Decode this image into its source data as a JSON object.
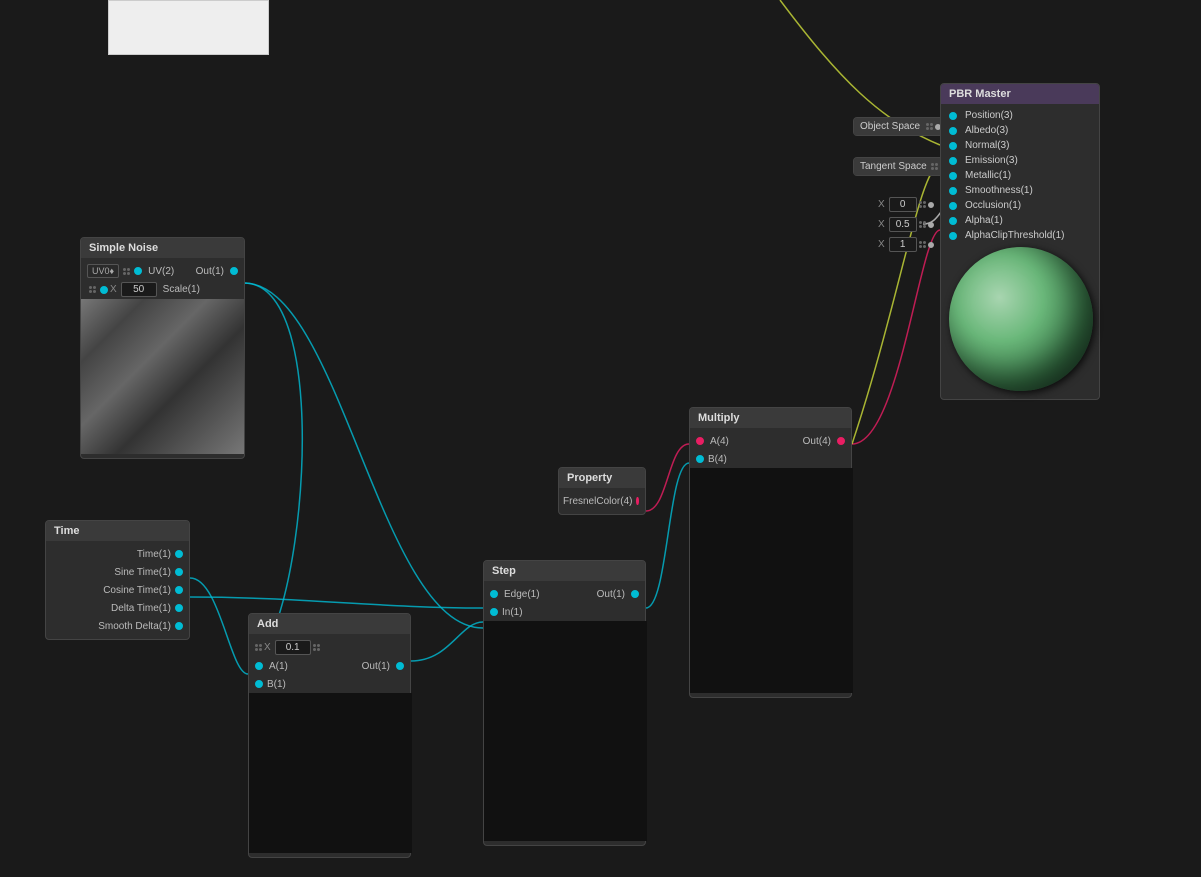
{
  "canvas": {
    "background": "#1e1e1e"
  },
  "whitebox": {
    "label": ""
  },
  "nodes": {
    "pbr_master": {
      "title": "PBR Master",
      "outputs": [
        {
          "label": "Position(3)"
        },
        {
          "label": "Albedo(3)"
        },
        {
          "label": "Normal(3)"
        },
        {
          "label": "Emission(3)"
        },
        {
          "label": "Metallic(1)"
        },
        {
          "label": "Smoothness(1)"
        },
        {
          "label": "Occlusion(1)"
        },
        {
          "label": "Alpha(1)"
        },
        {
          "label": "AlphaClipThreshold(1)"
        }
      ]
    },
    "object_space": {
      "title": "Object Space"
    },
    "tangent_space": {
      "title": "Tangent Space"
    },
    "simple_noise": {
      "title": "Simple Noise",
      "inputs": [
        {
          "label": "UV(2)",
          "type": "cyan"
        },
        {
          "label": "Scale(1)",
          "type": "cyan"
        }
      ],
      "outputs": [
        {
          "label": "Out(1)",
          "type": "cyan"
        }
      ],
      "uv_value": "UV0♦",
      "scale_value": "50"
    },
    "time": {
      "title": "Time",
      "outputs": [
        {
          "label": "Time(1)"
        },
        {
          "label": "Sine Time(1)"
        },
        {
          "label": "Cosine Time(1)"
        },
        {
          "label": "Delta Time(1)"
        },
        {
          "label": "Smooth Delta(1)"
        }
      ]
    },
    "add": {
      "title": "Add",
      "inputs": [
        {
          "label": "A(1)"
        },
        {
          "label": "B(1)"
        }
      ],
      "outputs": [
        {
          "label": "Out(1)"
        }
      ],
      "x_value": "0.1"
    },
    "step": {
      "title": "Step",
      "inputs": [
        {
          "label": "Edge(1)"
        },
        {
          "label": "In(1)"
        }
      ],
      "outputs": [
        {
          "label": "Out(1)"
        }
      ]
    },
    "property": {
      "title": "Property",
      "output_label": "FresnelColor(4)"
    },
    "multiply": {
      "title": "Multiply",
      "inputs": [
        {
          "label": "A(4)"
        },
        {
          "label": "B(4)"
        }
      ],
      "outputs": [
        {
          "label": "Out(4)"
        }
      ]
    },
    "x0": {
      "value": "0"
    },
    "x05": {
      "value": "0.5"
    },
    "x1": {
      "value": "1"
    }
  }
}
